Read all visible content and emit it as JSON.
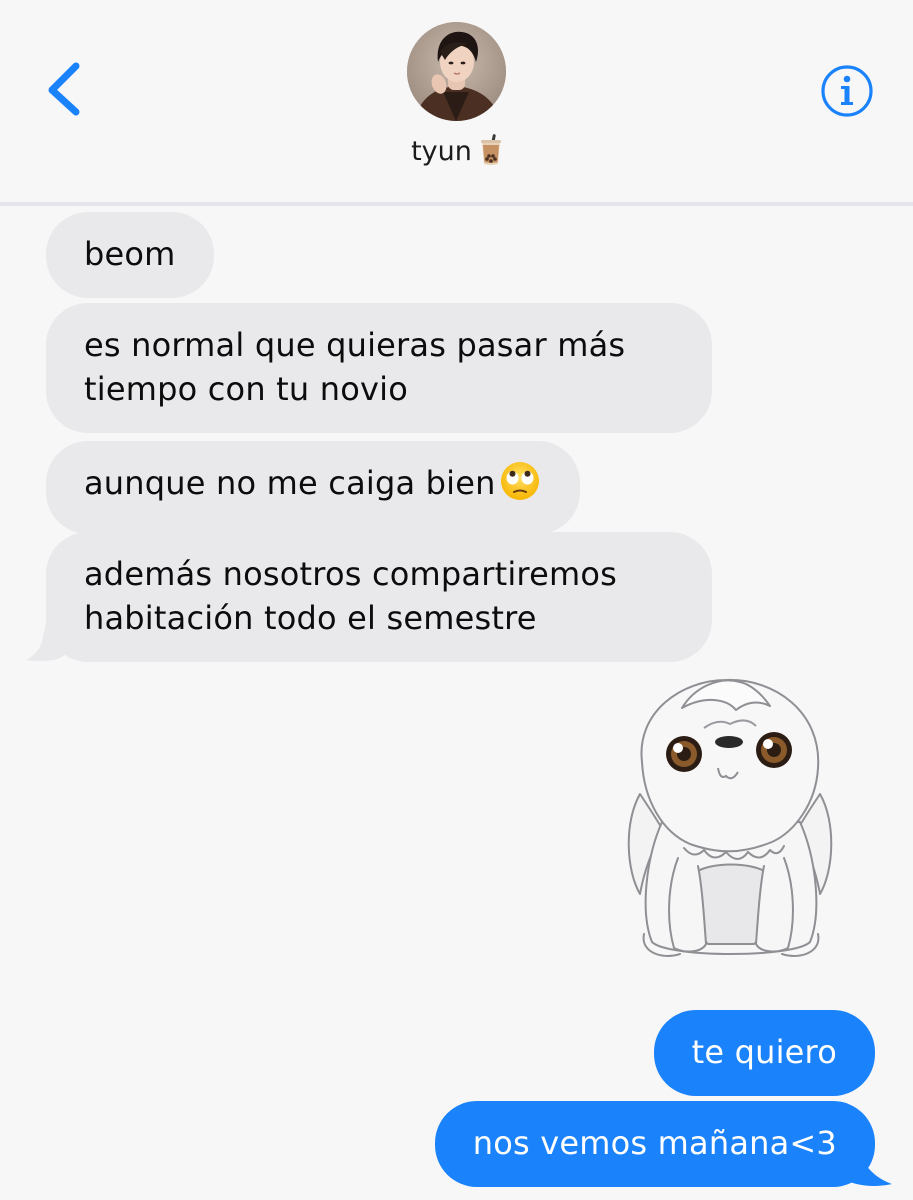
{
  "header": {
    "contact_name": "tyun",
    "contact_emoji": "bubble-tea-icon",
    "back_icon": "chevron-left-icon",
    "info_icon": "info-circle-icon"
  },
  "colors": {
    "accent": "#1a82fb",
    "incoming_bubble": "#e9e9eb",
    "background": "#f7f7f8"
  },
  "messages": [
    {
      "direction": "incoming",
      "lines": [
        "beom"
      ]
    },
    {
      "direction": "incoming",
      "lines": [
        "es normal que quieras pasar más",
        "tiempo con tu novio"
      ]
    },
    {
      "direction": "incoming",
      "lines": [
        "aunque no me caiga bien"
      ],
      "emoji": "eye-roll-emoji-icon"
    },
    {
      "direction": "incoming",
      "lines": [
        "además nosotros compartiremos",
        "habitación todo el semestre"
      ]
    },
    {
      "direction": "outgoing",
      "type": "sticker",
      "sticker": "white-fluffy-creature-sticker"
    },
    {
      "direction": "outgoing",
      "lines": [
        "te quiero"
      ]
    },
    {
      "direction": "outgoing",
      "lines": [
        "nos vemos mañana<3"
      ]
    }
  ]
}
